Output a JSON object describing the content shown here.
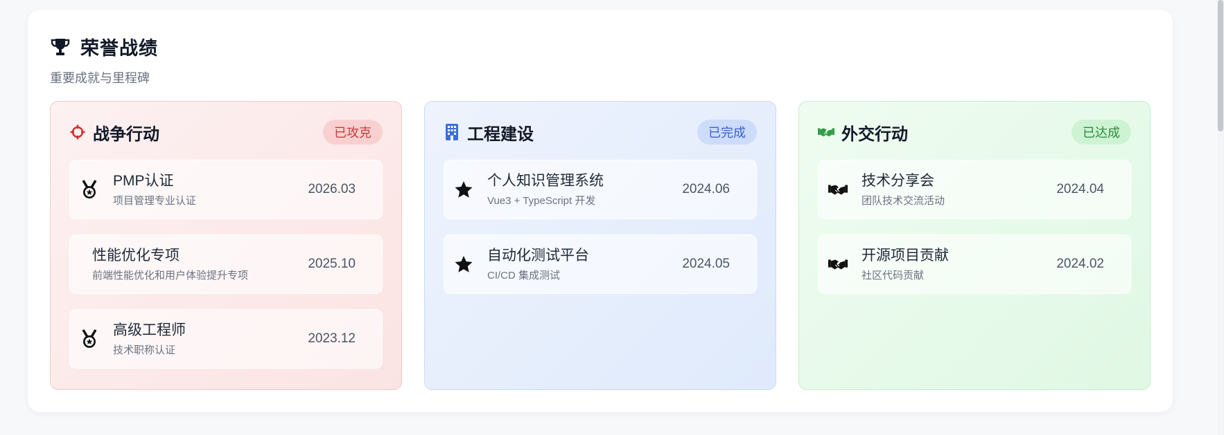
{
  "header": {
    "title": "荣誉战绩",
    "subtitle": "重要成就与里程碑",
    "icon": "trophy-icon"
  },
  "cards": [
    {
      "title": "战争行动",
      "badge": "已攻克",
      "icon": "crosshair-icon",
      "accent": "#d32f2f",
      "items": [
        {
          "title": "PMP认证",
          "desc": "项目管理专业认证",
          "date": "2026.03",
          "icon": "medal-icon"
        },
        {
          "title": "性能优化专项",
          "desc": "前端性能优化和用户体验提升专项",
          "date": "2025.10",
          "icon": ""
        },
        {
          "title": "高级工程师",
          "desc": "技术职称认证",
          "date": "2023.12",
          "icon": "medal-icon"
        }
      ]
    },
    {
      "title": "工程建设",
      "badge": "已完成",
      "icon": "building-icon",
      "accent": "#3b6fd8",
      "items": [
        {
          "title": "个人知识管理系统",
          "desc": "Vue3 + TypeScript 开发",
          "date": "2024.06",
          "icon": "star-icon"
        },
        {
          "title": "自动化测试平台",
          "desc": "CI/CD 集成测试",
          "date": "2024.05",
          "icon": "star-icon"
        }
      ]
    },
    {
      "title": "外交行动",
      "badge": "已达成",
      "icon": "handshake-icon",
      "accent": "#2f9e44",
      "items": [
        {
          "title": "技术分享会",
          "desc": "团队技术交流活动",
          "date": "2024.04",
          "icon": "handshake-icon"
        },
        {
          "title": "开源项目贡献",
          "desc": "社区代码贡献",
          "date": "2024.02",
          "icon": "handshake-icon"
        }
      ]
    }
  ]
}
